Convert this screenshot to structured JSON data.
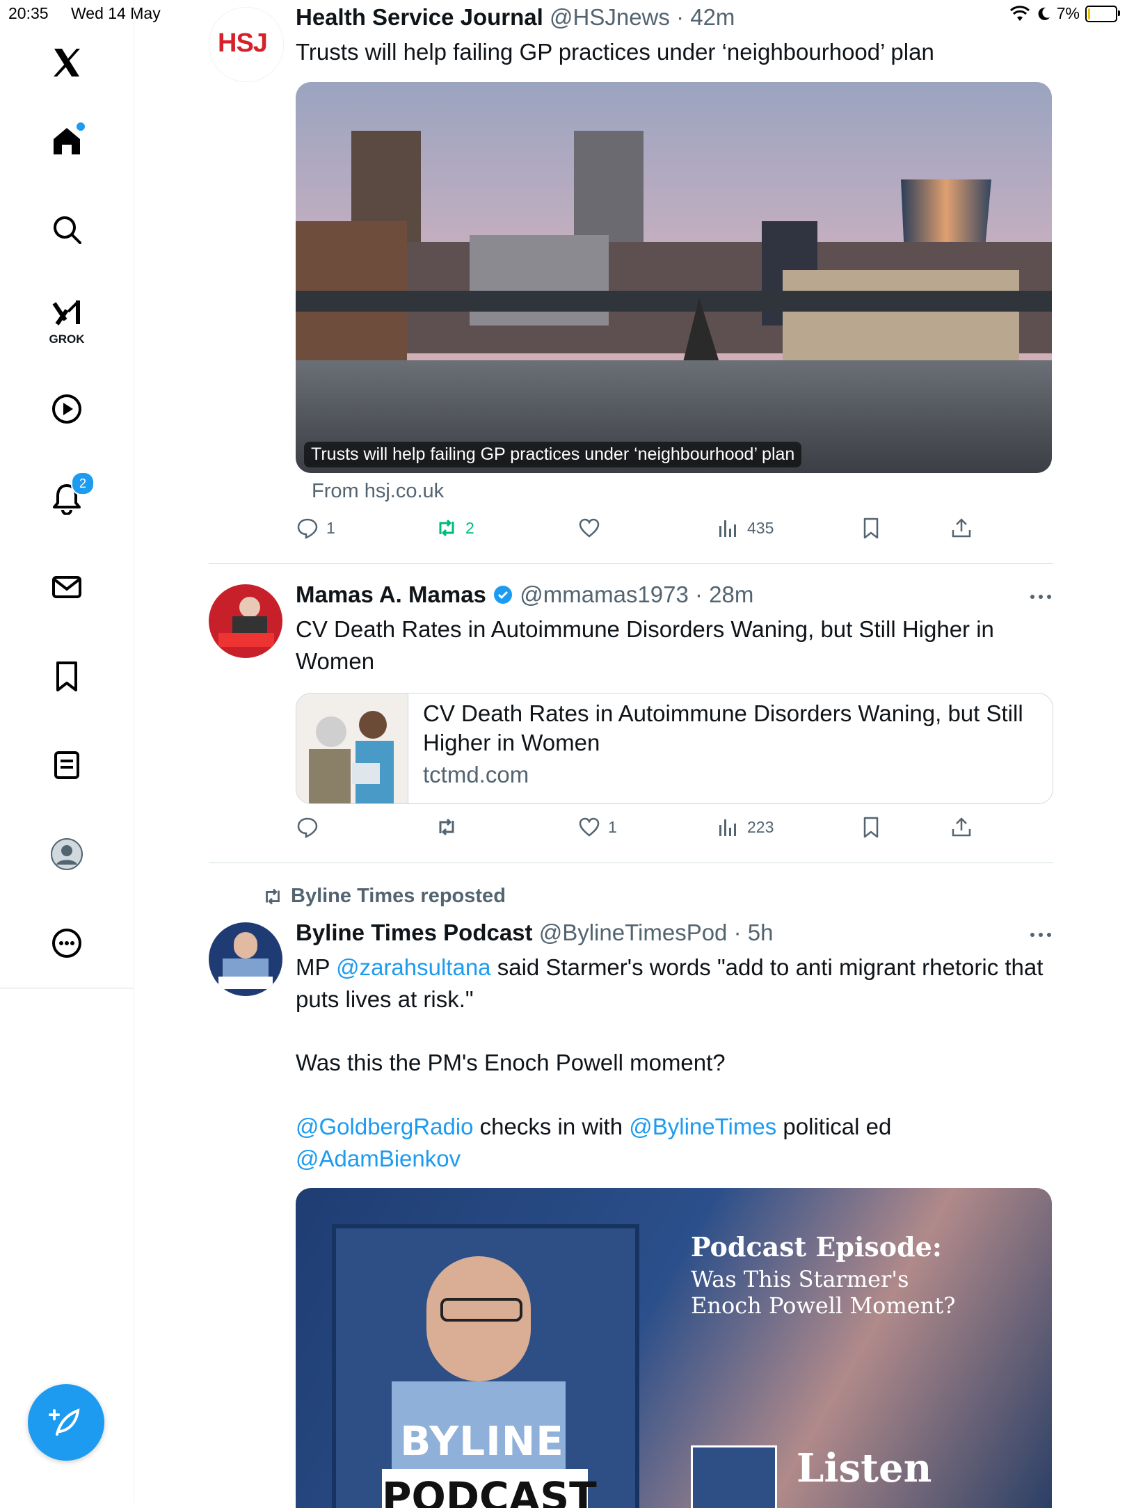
{
  "status_bar": {
    "time": "20:35",
    "date": "Wed 14 May",
    "battery": "7%",
    "battery_level": 0.07
  },
  "sidebar": {
    "grok_label": "GROK",
    "notification_count": "2"
  },
  "tweets": [
    {
      "name": "Health Service Journal",
      "handle": "@HSJnews",
      "time": "· 42m",
      "avatar_text": "HSJ",
      "text": "Trusts will help failing GP practices under ‘neighbourhood’ plan",
      "card_caption": "Trusts will help failing GP practices under ‘neighbourhood’ plan",
      "source": "From hsj.co.uk",
      "replies": "1",
      "reposts": "2",
      "likes": "",
      "views": "435"
    },
    {
      "name": "Mamas A. Mamas",
      "handle": "@mmamas1973",
      "time": "· 28m",
      "text": "CV Death Rates in Autoimmune Disorders Waning, but Still Higher in Women",
      "link_title": "CV Death Rates in Autoimmune Disorders Waning, but Still Higher in Women",
      "link_domain": "tctmd.com",
      "replies": "",
      "reposts": "",
      "likes": "1",
      "views": "223"
    },
    {
      "repost_label": "Byline Times reposted",
      "name": "Byline Times Podcast",
      "handle": "@BylineTimesPod",
      "time": "· 5h",
      "text_mp": "MP ",
      "mention_1": "@zarahsultana",
      "text_1": " said Starmer's words \"add to anti migrant rhetoric that puts lives at risk.\"",
      "text_2": "Was this the PM's Enoch Powell moment?",
      "mention_2": "@GoldbergRadio",
      "text_3": " checks in with ",
      "mention_3": "@BylineTimes",
      "text_4": " political ed",
      "mention_4": "@AdamBienkov",
      "podcast_title": "Podcast Episode:",
      "podcast_subtitle_1": "Was This Starmer's",
      "podcast_subtitle_2": "Enoch Powell Moment?",
      "podcast_brand_1": "BYLINE",
      "podcast_brand_2": "PODCAST",
      "listen_text": "Listen"
    }
  ]
}
